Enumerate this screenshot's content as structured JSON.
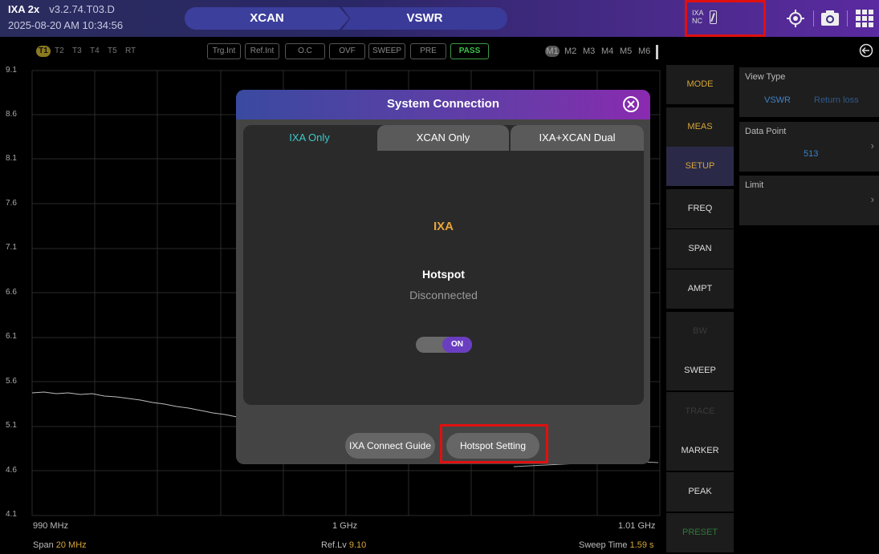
{
  "header": {
    "app_name": "IXA 2x",
    "version": "v3.2.74.T03.D",
    "datetime": "2025-08-20 AM 10:34:56",
    "breadcrumb": [
      "XCAN",
      "VSWR"
    ],
    "connection_label_1": "IXA",
    "connection_label_2": "NC"
  },
  "icons": {
    "connection": "battery-nc-icon",
    "locate": "crosshair-icon",
    "screenshot": "camera-icon",
    "apps": "grid-menu-icon",
    "back": "back-arrow-icon",
    "close": "close-circle-icon"
  },
  "traces": [
    "T1",
    "T2",
    "T3",
    "T4",
    "T5",
    "RT"
  ],
  "status_pills": [
    "Trg.Int",
    "Ref.Int",
    "O.C",
    "OVF",
    "SWEEP",
    "PRE",
    "PASS"
  ],
  "markers": [
    "M1",
    "M2",
    "M3",
    "M4",
    "M5",
    "M6"
  ],
  "plot": {
    "y_ticks": [
      "9.1",
      "8.6",
      "8.1",
      "7.6",
      "7.1",
      "6.6",
      "6.1",
      "5.6",
      "5.1",
      "4.6",
      "4.1"
    ],
    "x_start": "990 MHz",
    "x_center": "1 GHz",
    "x_end": "1.01 GHz",
    "span_label": "Span",
    "span_value": "20 MHz",
    "ref_label": "Ref.Lv",
    "ref_value": "9.10",
    "sweep_label": "Sweep Time",
    "sweep_value": "1.59 s"
  },
  "menu": [
    "MODE",
    "MEAS",
    "SETUP",
    "FREQ",
    "SPAN",
    "AMPT",
    "BW",
    "SWEEP",
    "TRACE",
    "MARKER",
    "PEAK",
    "PRESET"
  ],
  "settings": {
    "view_type_label": "View Type",
    "view_type_opt1": "VSWR",
    "view_type_opt2": "Return loss",
    "data_point_label": "Data Point",
    "data_point_value": "513",
    "limit_label": "Limit"
  },
  "modal": {
    "title": "System Connection",
    "tabs": [
      "IXA Only",
      "XCAN Only",
      "IXA+XCAN Dual"
    ],
    "device": "IXA",
    "hotspot_label": "Hotspot",
    "hotspot_status": "Disconnected",
    "toggle_label": "ON",
    "connect_guide": "IXA Connect Guide",
    "hotspot_setting": "Hotspot Setting"
  },
  "colors": {
    "accent_amber": "#d6a53a",
    "accent_teal": "#3cc8c8",
    "pass_green": "#3cc24a",
    "highlight_red": "#e01010"
  }
}
